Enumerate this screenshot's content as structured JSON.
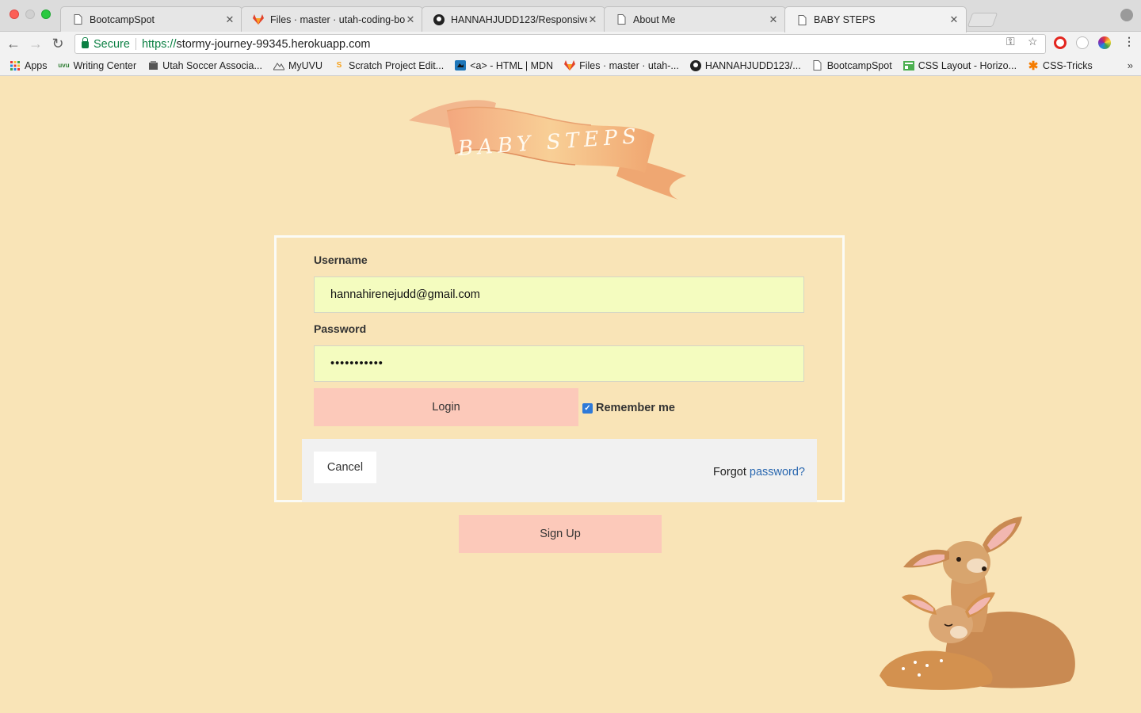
{
  "browser": {
    "tabs": [
      {
        "title": "BootcampSpot",
        "favicon": "page-icon",
        "active": false
      },
      {
        "title": "Files · master · utah-coding-bo",
        "favicon": "gitlab-icon",
        "active": false
      },
      {
        "title": "HANNAHJUDD123/Responsive",
        "favicon": "github-icon",
        "active": false
      },
      {
        "title": "About Me",
        "favicon": "page-icon",
        "active": false
      },
      {
        "title": "BABY STEPS",
        "favicon": "page-icon",
        "active": true
      }
    ],
    "address": {
      "secure_label": "Secure",
      "scheme": "https://",
      "host": "stormy-journey-99345.herokuapp.com"
    },
    "bookmarks": [
      {
        "label": "Apps",
        "icon": "apps-grid-icon"
      },
      {
        "label": "Writing Center",
        "icon": "uvu-icon"
      },
      {
        "label": "Utah Soccer Associa...",
        "icon": "soccer-icon"
      },
      {
        "label": "MyUVU",
        "icon": "mountain-icon"
      },
      {
        "label": "Scratch Project Edit...",
        "icon": "scratch-icon"
      },
      {
        "label": "<a> - HTML | MDN",
        "icon": "mdn-icon"
      },
      {
        "label": "Files · master · utah-...",
        "icon": "gitlab-icon"
      },
      {
        "label": "HANNAHJUDD123/...",
        "icon": "github-icon"
      },
      {
        "label": "BootcampSpot",
        "icon": "page-icon"
      },
      {
        "label": "CSS Layout - Horizo...",
        "icon": "css-layout-icon"
      },
      {
        "label": "CSS-Tricks",
        "icon": "css-tricks-icon"
      }
    ]
  },
  "page": {
    "banner_text": "BABY STEPS",
    "login": {
      "username_label": "Username",
      "username_value": "hannahirenejudd@gmail.com",
      "password_label": "Password",
      "password_value": "•••••••••••",
      "login_label": "Login",
      "remember_label": "Remember me",
      "remember_checked": true,
      "cancel_label": "Cancel",
      "forgot_prefix": "Forgot ",
      "forgot_link": "password?"
    },
    "signup_label": "Sign Up"
  },
  "colors": {
    "page_bg": "#f9e4b7",
    "input_bg": "#f4fcbf",
    "button_bg": "#fcc9ba",
    "link": "#2a68b0"
  }
}
